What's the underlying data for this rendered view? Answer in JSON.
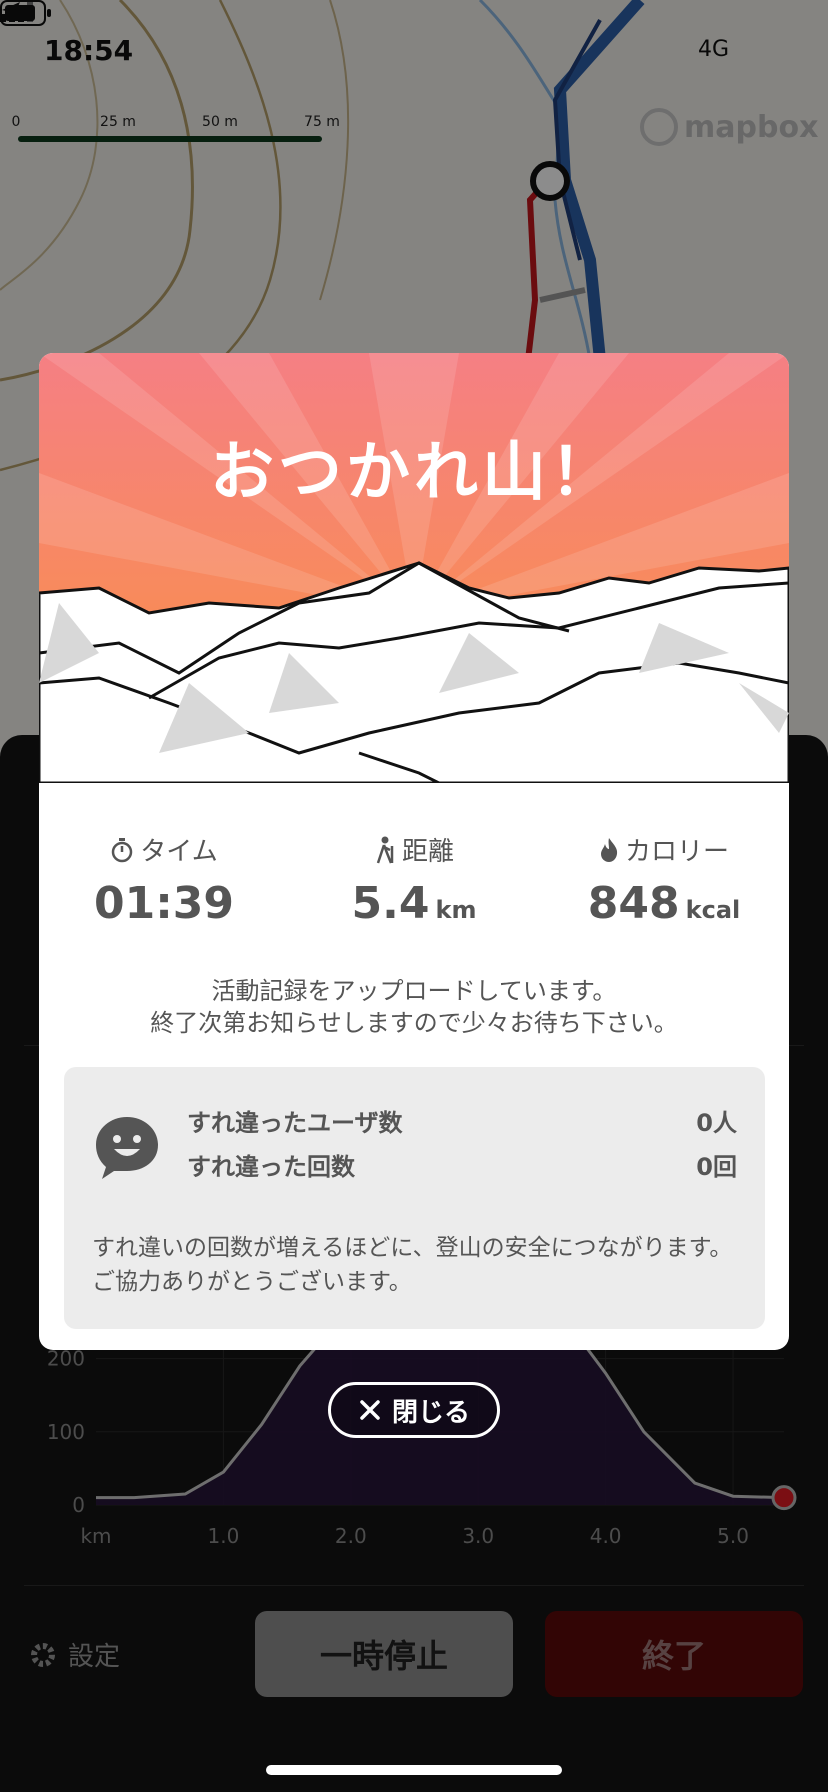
{
  "status_bar": {
    "time": "18:54",
    "network": "4G"
  },
  "map": {
    "scale_ticks": [
      "0",
      "25 m",
      "50 m",
      "75 m"
    ],
    "attribution": "mapbox"
  },
  "modal": {
    "title": "おつかれ山！",
    "stats": [
      {
        "label": "タイム",
        "icon": "stopwatch-icon",
        "value": "01:39",
        "unit": ""
      },
      {
        "label": "距離",
        "icon": "hiker-icon",
        "value": "5.4",
        "unit": "km"
      },
      {
        "label": "カロリー",
        "icon": "flame-icon",
        "value": "848",
        "unit": "kcal"
      }
    ],
    "upload_message_line1": "活動記録をアップロードしています。",
    "upload_message_line2": "終了次第お知らせしますので少々お待ち下さい。",
    "encounters": {
      "users_label": "すれ違ったユーザ数",
      "users_value": "0人",
      "count_label": "すれ違った回数",
      "count_value": "0回",
      "note": "すれ違いの回数が増えるほどに、登山の安全につながります。ご協力ありがとうございます。"
    },
    "close_label": "閉じる"
  },
  "chart_data": {
    "type": "area",
    "title": "",
    "xlabel": "km",
    "ylabel": "",
    "x_ticks": [
      "1.0",
      "2.0",
      "3.0",
      "4.0",
      "5.0"
    ],
    "y_ticks": [
      "0",
      "100",
      "200"
    ],
    "x": [
      0.0,
      0.3,
      0.7,
      1.0,
      1.3,
      1.6,
      1.9,
      2.2,
      2.5,
      2.8,
      3.1,
      3.4,
      3.7,
      4.0,
      4.3,
      4.7,
      5.0,
      5.4
    ],
    "values": [
      10,
      10,
      15,
      45,
      110,
      190,
      250,
      270,
      270,
      270,
      270,
      270,
      250,
      180,
      100,
      30,
      12,
      10
    ],
    "xlim": [
      0,
      5.4
    ],
    "ylim": [
      0,
      280
    ],
    "colors": {
      "line": "#c8c8c8",
      "fill": "#2a1640",
      "endpoint": "#e01b24"
    }
  },
  "footer": {
    "settings_label": "設定",
    "pause_label": "一時停止",
    "end_label": "終了"
  }
}
